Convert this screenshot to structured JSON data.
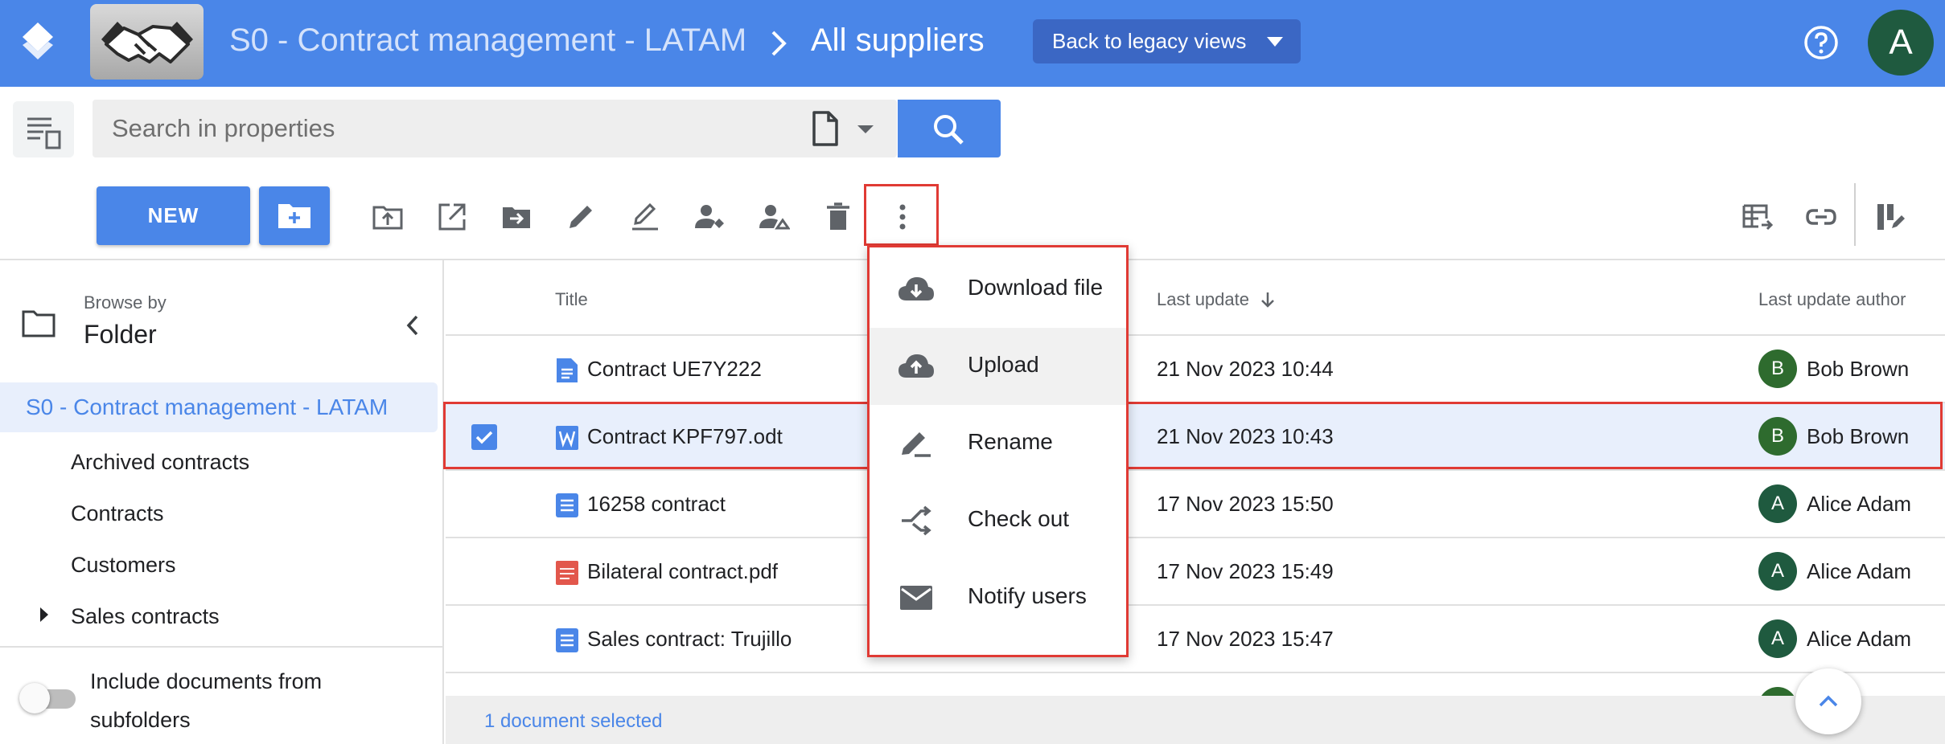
{
  "header": {
    "space_name": "S0 - Contract management - LATAM",
    "page_title": "All suppliers",
    "legacy_button": "Back to legacy views",
    "user_initial": "A",
    "brand_color": "#4a86e8"
  },
  "search": {
    "placeholder": "Search in properties",
    "doctype_icon": "document-icon",
    "button_icon": "search-icon"
  },
  "toolbar": {
    "new_label": "NEW",
    "actions": [
      "new-folder-icon",
      "move-up-icon",
      "open-external-icon",
      "move-to-icon",
      "edit-icon",
      "edit-properties-icon",
      "assign-icon",
      "manage-access-icon",
      "delete-icon",
      "more-vert-icon"
    ],
    "right_actions": [
      "export-table-icon",
      "link-icon",
      "column-settings-icon"
    ]
  },
  "sidebar": {
    "browse_by": "Browse by",
    "browse_mode": "Folder",
    "root": "S0 - Contract management - LATAM",
    "items": [
      {
        "label": "Archived contracts"
      },
      {
        "label": "Contracts"
      },
      {
        "label": "Customers"
      },
      {
        "label": "Sales contracts"
      }
    ],
    "include_subfolders_label": "Include documents from subfolders",
    "include_subfolders": false
  },
  "table": {
    "columns": [
      "Title",
      "Last update",
      "Last update author"
    ],
    "sort_column": "Last update",
    "sort_direction": "descending",
    "rows": [
      {
        "title": "Contract UE7Y222",
        "updated": "21 Nov 2023 10:44",
        "author": "Bob Brown",
        "initial": "B",
        "type": "gdoc",
        "selected": false
      },
      {
        "title": "Contract KPF797.odt",
        "updated": "21 Nov 2023 10:43",
        "author": "Bob Brown",
        "initial": "B",
        "type": "word",
        "selected": true
      },
      {
        "title": "16258 contract",
        "updated": "17 Nov 2023 15:50",
        "author": "Alice Adam",
        "initial": "A",
        "type": "note",
        "selected": false
      },
      {
        "title": "Bilateral contract.pdf",
        "updated": "17 Nov 2023 15:49",
        "author": "Alice Adam",
        "initial": "A",
        "type": "pdf",
        "selected": false
      },
      {
        "title": "Sales contract: Trujillo",
        "updated": "17 Nov 2023 15:47",
        "author": "Alice Adam",
        "initial": "A",
        "type": "note",
        "selected": false
      }
    ]
  },
  "status": {
    "selection_text": "1 document selected"
  },
  "menu": {
    "items": [
      {
        "label": "Download file",
        "icon": "cloud-download-icon"
      },
      {
        "label": "Upload",
        "icon": "cloud-upload-icon"
      },
      {
        "label": "Rename",
        "icon": "rename-icon"
      },
      {
        "label": "Check out",
        "icon": "checkout-icon"
      },
      {
        "label": "Notify users",
        "icon": "mail-icon"
      }
    ]
  }
}
